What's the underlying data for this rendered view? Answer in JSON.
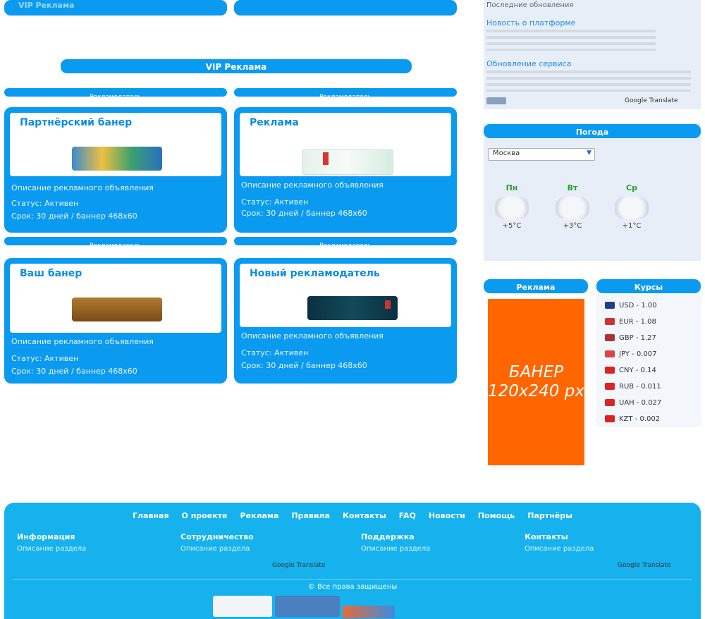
{
  "left": {
    "top_pills": [
      {
        "label": "VIP Реклама"
      },
      {
        "label": ""
      }
    ],
    "section_title": "VIP Реклама",
    "cards": [
      {
        "header": "Рекламодатель",
        "title": "Партнёрский банер",
        "desc": "Описание рекламного объявления",
        "line1": "Статус: Активен",
        "line2": "Срок: 30 дней / баннер 468x60",
        "banner_color": "#5a9fd4"
      },
      {
        "header": "Рекламодатель",
        "title": "Реклама",
        "desc": "Описание рекламного объявления",
        "line1": "Статус: Активен",
        "line2": "Срок: 30 дней / баннер 468x60",
        "banner_color": "#e9f4ee"
      },
      {
        "header": "Рекламодатель",
        "title": "Ваш банер",
        "desc": "Описание рекламного объявления",
        "line1": "Статус: Активен",
        "line2": "Срок: 30 дней / баннер 468x60",
        "banner_color": "#8a5a1c"
      },
      {
        "header": "Рекламодатель",
        "title": "Новый рекламодатель",
        "desc": "Описание рекламного объявления",
        "line1": "Статус: Активен",
        "line2": "Срок: 30 дней / баннер 468x60",
        "banner_color": "#0d3a4a"
      }
    ]
  },
  "sidebar": {
    "news": [
      {
        "text": "Последние обновления"
      },
      {
        "text": "Новость о платформе"
      },
      {
        "text": "Обновление сервиса"
      }
    ],
    "translate_label": "Google Translate",
    "weather": {
      "title": "Погода",
      "select_value": "Москва",
      "days": [
        {
          "name": "Пн",
          "temp": "+5°C",
          "color": "#2aa02a"
        },
        {
          "name": "Вт",
          "temp": "+3°C",
          "color": "#2aa02a"
        },
        {
          "name": "Ср",
          "temp": "+1°C",
          "color": "#2aa02a"
        }
      ]
    },
    "banner": {
      "title": "Реклама",
      "text": "БАНЕР\n120x240 px"
    },
    "currency": {
      "title": "Курсы",
      "rows": [
        {
          "code": "USD",
          "rate": "1.00",
          "color": "#1f3f8a"
        },
        {
          "code": "EUR",
          "rate": "1.08",
          "color": "#c33"
        },
        {
          "code": "GBP",
          "rate": "1.27",
          "color": "#a33"
        },
        {
          "code": "JPY",
          "rate": "0.007",
          "color": "#d44"
        },
        {
          "code": "CNY",
          "rate": "0.14",
          "color": "#d22"
        },
        {
          "code": "RUB",
          "rate": "0.011",
          "color": "#d22"
        },
        {
          "code": "UAH",
          "rate": "0.027",
          "color": "#d22"
        },
        {
          "code": "KZT",
          "rate": "0.002",
          "color": "#d22"
        }
      ]
    }
  },
  "footer": {
    "nav": [
      "Главная",
      "О проекте",
      "Реклама",
      "Правила",
      "Контакты",
      "FAQ",
      "Новости",
      "Помощь",
      "Партнёры"
    ],
    "columns": [
      {
        "heading": "Информация",
        "text": "Описание раздела"
      },
      {
        "heading": "Сотрудничество",
        "text": "Описание раздела"
      },
      {
        "heading": "Поддержка",
        "text": "Описание раздела"
      },
      {
        "heading": "Контакты",
        "text": "Описание раздела"
      }
    ],
    "copyright": "© Все права защищены"
  },
  "colors": {
    "accent": "#0a9af0",
    "footer": "#16b2ee",
    "banner": "#ff6600"
  }
}
